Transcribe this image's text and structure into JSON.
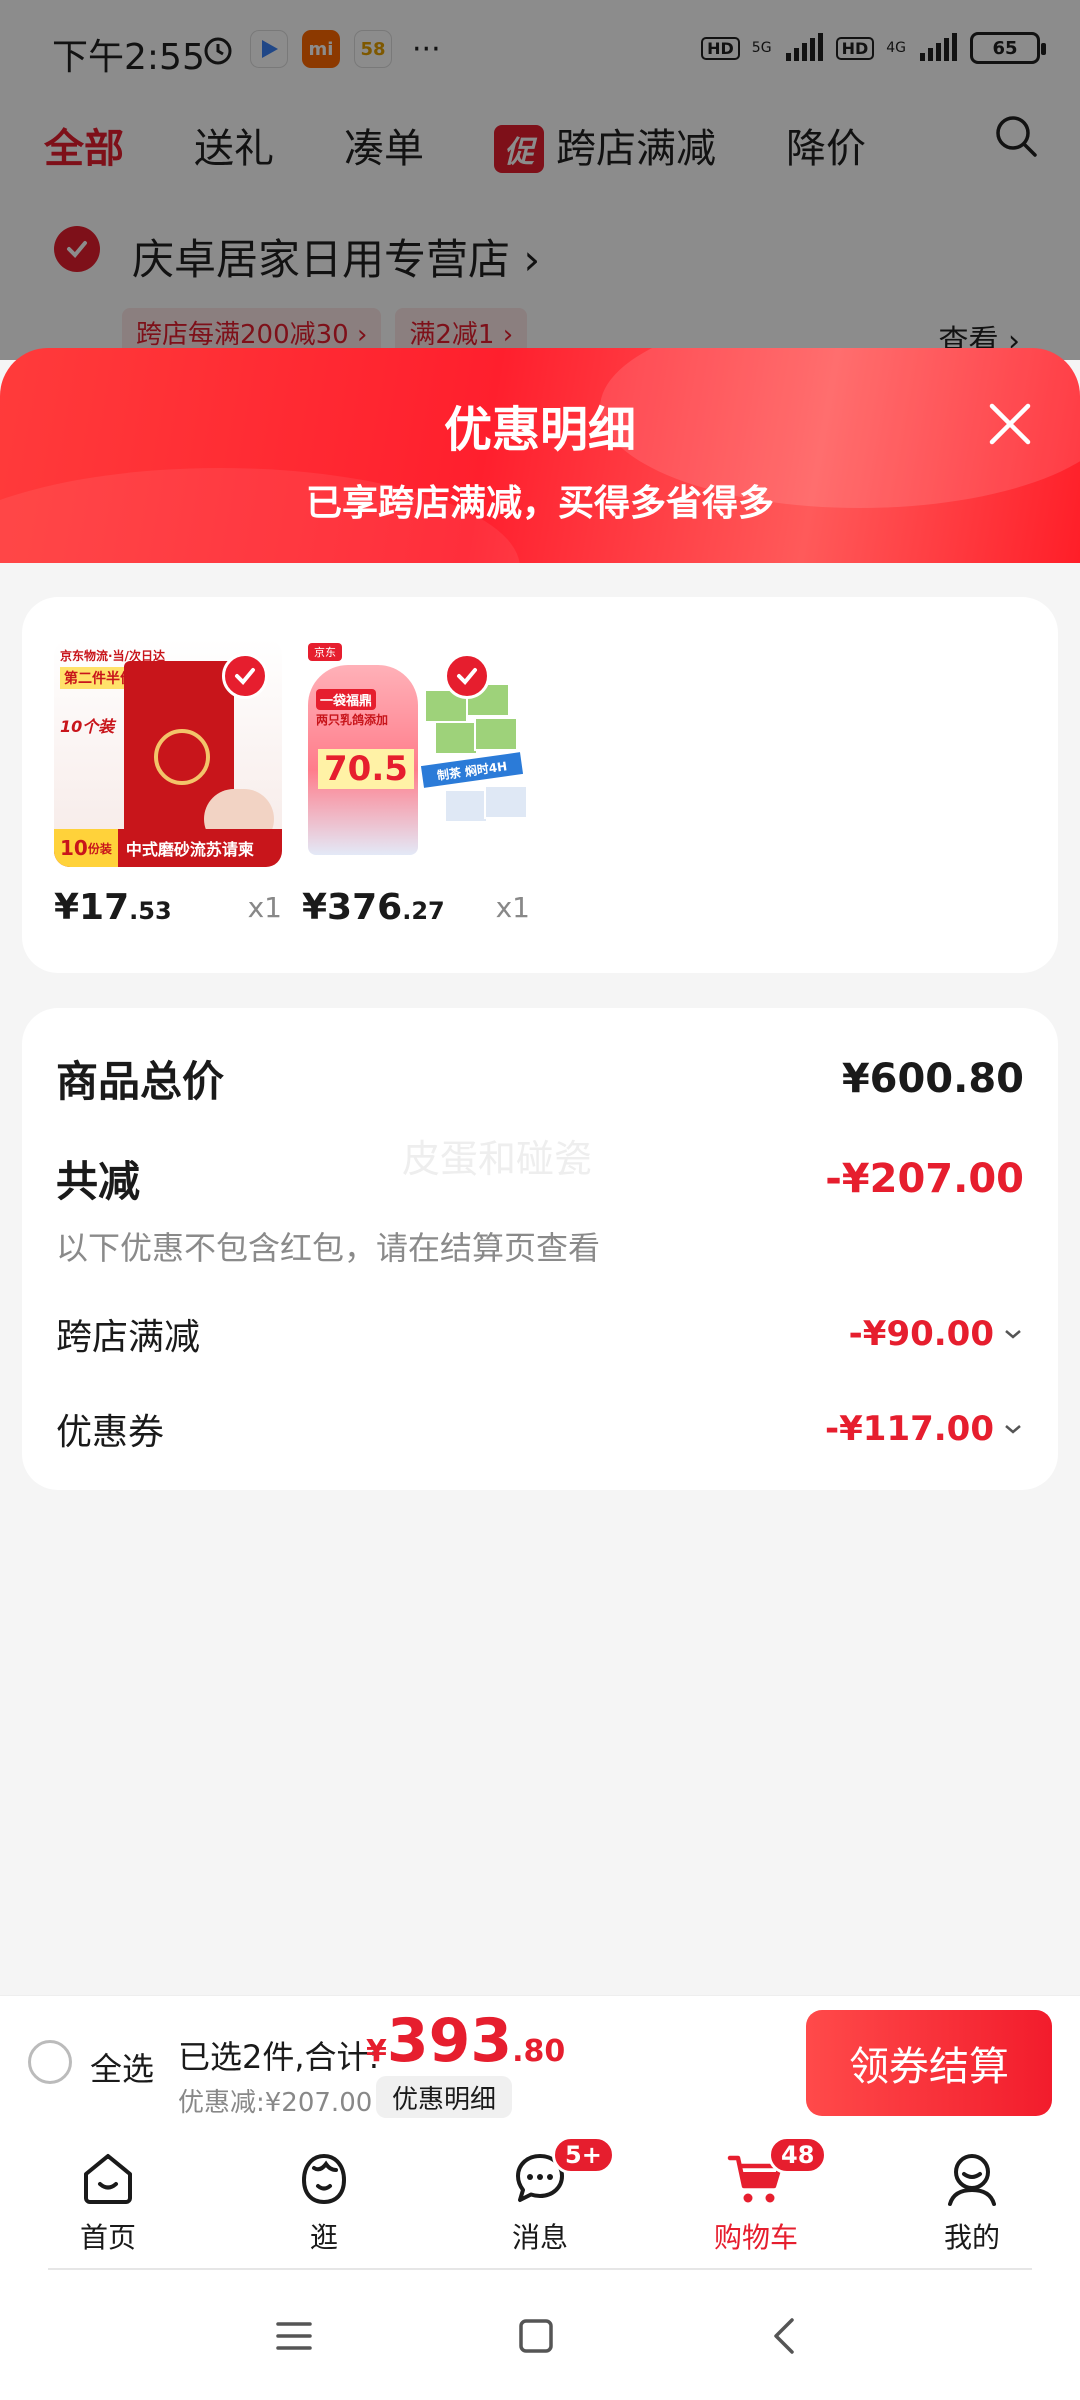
{
  "status_bar": {
    "time": "下午2:55",
    "apps": [
      {
        "name": "alarm-icon"
      },
      {
        "name": "play-icon"
      },
      {
        "label": "mi",
        "color": "#ff6900"
      },
      {
        "label": "58",
        "color": "#ffffff"
      }
    ],
    "more": "···",
    "hd1": "HD",
    "net1": "5G",
    "hd2": "HD",
    "net2": "4G",
    "battery": "65"
  },
  "tabs": {
    "items": [
      "全部",
      "送礼",
      "凑单",
      "跨店满减",
      "降价"
    ],
    "promo_tag": "促",
    "active_index": 0
  },
  "store": {
    "name": "庆卓居家日用专营店",
    "tags": [
      "跨店每满200减30",
      "满2减1"
    ],
    "view_label": "查看"
  },
  "sheet": {
    "title": "优惠明细",
    "subtitle": "已享跨店满减，买得多省得多"
  },
  "products": [
    {
      "price_int": "¥17",
      "price_dec": ".53",
      "qty": "x1",
      "image_text": {
        "a": "京东物流·当/次日达",
        "b": "第二件半价",
        "c": "10个装",
        "num": "10",
        "unit": "份装",
        "desc": "中式磨砂流苏请柬"
      }
    },
    {
      "price_int": "¥376",
      "price_dec": ".27",
      "qty": "x1",
      "image_text": {
        "top": "京东",
        "badge": "一袋福鼎",
        "line": "两只乳鸽添加",
        "num": "70.5",
        "stripe": "制茶 焖时4H"
      }
    }
  ],
  "summary": {
    "total_label": "商品总价",
    "total_value": "¥600.80",
    "reduce_label": "共减",
    "reduce_value": "-¥207.00",
    "note": "以下优惠不包含红包，请在结算页查看",
    "items": [
      {
        "label": "跨店满减",
        "value": "-¥90.00"
      },
      {
        "label": "优惠券",
        "value": "-¥117.00"
      }
    ],
    "watermark": "皮蛋和碰瓷"
  },
  "checkout": {
    "select_all": "全选",
    "selected_text": "已选2件,合计:",
    "currency": "¥",
    "total_int": "393",
    "total_dec": ".80",
    "discount_text": "优惠减:¥207.00",
    "detail_button": "优惠明细",
    "checkout_button": "领券结算"
  },
  "bottom_nav": {
    "items": [
      {
        "label": "首页",
        "icon": "home-icon"
      },
      {
        "label": "逛",
        "icon": "discover-icon"
      },
      {
        "label": "消息",
        "icon": "message-icon",
        "badge": "5+"
      },
      {
        "label": "购物车",
        "icon": "cart-icon",
        "badge": "48"
      },
      {
        "label": "我的",
        "icon": "profile-icon"
      }
    ],
    "active_index": 3
  },
  "colors": {
    "accent": "#e61e2e",
    "muted": "#888888"
  }
}
